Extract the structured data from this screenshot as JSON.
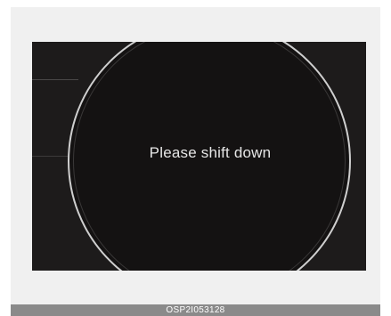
{
  "display": {
    "message": "Please shift down"
  },
  "caption": {
    "code": "OSP2I053128"
  },
  "colors": {
    "screen_background": "#1d1b1b",
    "gauge_ring": "#cfcfcf",
    "message_text": "#e6e6e6",
    "caption_background": "#8a8a8a"
  }
}
